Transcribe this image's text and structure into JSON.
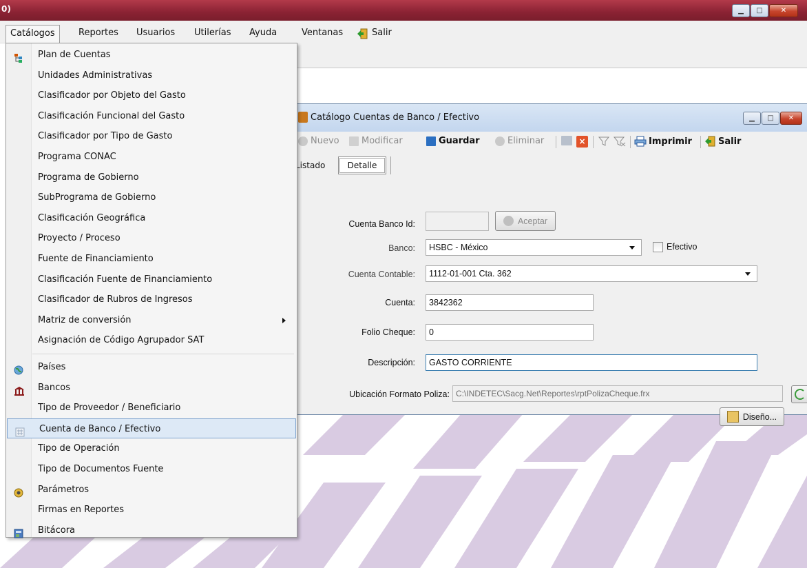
{
  "outer_window": {
    "title": "0)",
    "btn_min": "▁",
    "btn_max": "□",
    "btn_close": "✕"
  },
  "menubar": {
    "items": [
      "Catálogos",
      "Reportes",
      "Usuarios",
      "Utilerías",
      "Ayuda",
      "Ventanas",
      "Salir"
    ]
  },
  "dropdown": {
    "items": [
      {
        "label": "Plan de Cuentas",
        "icon": "tree-icon"
      },
      {
        "label": "Unidades Administrativas"
      },
      {
        "label": "Clasificador por Objeto del Gasto"
      },
      {
        "label": "Clasificación Funcional del Gasto"
      },
      {
        "label": "Clasificador por Tipo de Gasto"
      },
      {
        "label": "Programa CONAC"
      },
      {
        "label": "Programa de Gobierno"
      },
      {
        "label": "SubPrograma de Gobierno"
      },
      {
        "label": "Clasificación Geográfica"
      },
      {
        "label": "Proyecto / Proceso"
      },
      {
        "label": "Fuente de Financiamiento"
      },
      {
        "label": "Clasificación Fuente de Financiamiento"
      },
      {
        "label": "Clasificador de Rubros de Ingresos"
      },
      {
        "label": "Matriz de conversión",
        "submenu": true
      },
      {
        "label": "Asignación de Código Agrupador SAT"
      },
      {
        "label": "Países",
        "icon": "globe-icon"
      },
      {
        "label": "Bancos",
        "icon": "bank-icon"
      },
      {
        "label": "Tipo de Proveedor / Beneficiario"
      },
      {
        "label": "Cuenta de Banco / Efectivo",
        "icon": "grid-icon",
        "selected": true
      },
      {
        "label": "Tipo de Operación"
      },
      {
        "label": "Tipo de Documentos Fuente"
      },
      {
        "label": "Parámetros",
        "icon": "settings-icon"
      },
      {
        "label": "Firmas en Reportes"
      },
      {
        "label": "Bitácora",
        "icon": "log-icon"
      }
    ]
  },
  "child_window": {
    "title": "Catálogo Cuentas de Banco / Efectivo",
    "toolbar": {
      "nuevo": "Nuevo",
      "modificar": "Modificar",
      "guardar": "Guardar",
      "eliminar": "Eliminar",
      "imprimir": "Imprimir",
      "salir": "Salir"
    },
    "tabs": {
      "listado": "Listado",
      "detalle": "Detalle"
    },
    "form": {
      "cuenta_banco_id_label": "Cuenta Banco Id:",
      "cuenta_banco_id_value": "",
      "aceptar": "Aceptar",
      "banco_label": "Banco:",
      "banco_value": "HSBC - México",
      "efectivo_label": "Efectivo",
      "cuenta_contable_label": "Cuenta Contable:",
      "cuenta_contable_value": "1112-01-001 Cta. 362",
      "cuenta_label": "Cuenta:",
      "cuenta_value": "3842362",
      "folio_label": "Folio Cheque:",
      "folio_value": "0",
      "descripcion_label": "Descripción:",
      "descripcion_value": "GASTO CORRIENTE",
      "ubicacion_label": "Ubicación Formato Poliza:",
      "ubicacion_value": "C:\\INDETEC\\Sacg.Net\\Reportes\\rptPolizaCheque.frx",
      "diseno": "Diseño..."
    }
  },
  "colors": {
    "stripe": "#d7c8e0",
    "selection": "#dde9f6",
    "title_red": "#8a2233"
  }
}
